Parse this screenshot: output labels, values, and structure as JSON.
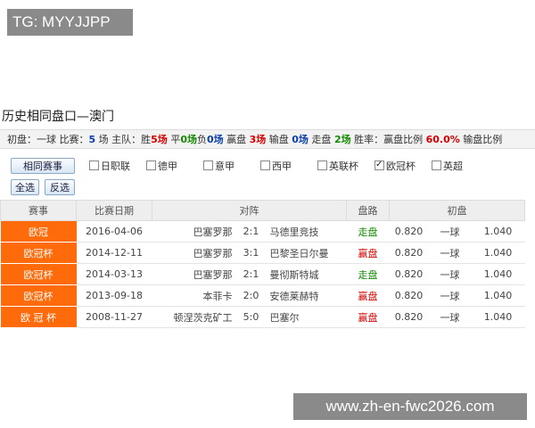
{
  "watermark_top": "TG: MYYJJPP",
  "watermark_bottom": "www.zh-en-fwc2026.com",
  "title": "历史相同盘口—澳门",
  "summary": {
    "initial_label": "初盘：",
    "initial_value": "一球",
    "matches_label": "比赛：",
    "matches_count": "5",
    "matches_unit": "场",
    "home_label": "主队：",
    "win_label": "胜",
    "win_count": "5场",
    "draw_label": "平",
    "draw_count": "0场",
    "loss_label": "负",
    "loss_count": "0场",
    "won_label": "赢盘",
    "won_count": "3场",
    "lost_label": "输盘",
    "lost_count": "0场",
    "push_label": "走盘",
    "push_count": "2场",
    "rate_label": "胜率：",
    "won_ratio_label": "赢盘比例",
    "won_ratio": "60.0%",
    "lost_ratio_label": "输盘比例"
  },
  "filter": {
    "league_filter_button": "相同赛事",
    "select_all": "全选",
    "invert": "反选",
    "leagues": [
      {
        "label": "日职联",
        "checked": false
      },
      {
        "label": "德甲",
        "checked": false
      },
      {
        "label": "意甲",
        "checked": false
      },
      {
        "label": "西甲",
        "checked": false
      },
      {
        "label": "英联杯",
        "checked": false
      },
      {
        "label": "欧冠杯",
        "checked": true
      },
      {
        "label": "英超",
        "checked": false
      }
    ]
  },
  "table": {
    "headers": {
      "league": "赛事",
      "date": "比赛日期",
      "match": "对阵",
      "result": "盘路",
      "initial": "初盘"
    },
    "rows": [
      {
        "league": "欧冠",
        "date": "2016-04-06",
        "home": "巴塞罗那",
        "score": "2:1",
        "away": "马德里竞技",
        "result": "走盘",
        "result_color": "#128a00",
        "odds_home": "0.820",
        "line": "一球",
        "odds_away": "1.040"
      },
      {
        "league": "欧冠杯",
        "date": "2014-12-11",
        "home": "巴塞罗那",
        "score": "3:1",
        "away": "巴黎圣日尔曼",
        "result": "赢盘",
        "result_color": "#d40000",
        "odds_home": "0.820",
        "line": "一球",
        "odds_away": "1.040"
      },
      {
        "league": "欧冠杯",
        "date": "2014-03-13",
        "home": "巴塞罗那",
        "score": "2:1",
        "away": "曼彻斯特城",
        "result": "走盘",
        "result_color": "#128a00",
        "odds_home": "0.820",
        "line": "一球",
        "odds_away": "1.040"
      },
      {
        "league": "欧冠杯",
        "date": "2013-09-18",
        "home": "本菲卡",
        "score": "2:0",
        "away": "安德莱赫特",
        "result": "赢盘",
        "result_color": "#d40000",
        "odds_home": "0.820",
        "line": "一球",
        "odds_away": "1.040"
      },
      {
        "league": "欧 冠 杯",
        "date": "2008-11-27",
        "home": "顿涅茨克矿工",
        "score": "5:0",
        "away": "巴塞尔",
        "result": "赢盘",
        "result_color": "#d40000",
        "odds_home": "0.820",
        "line": "一球",
        "odds_away": "1.040"
      }
    ]
  },
  "colors": {
    "league_badge": "#ff6a0a",
    "win": "#d40000",
    "push": "#128a00",
    "draw": "#128a00",
    "loss": "#0a3fa8"
  }
}
